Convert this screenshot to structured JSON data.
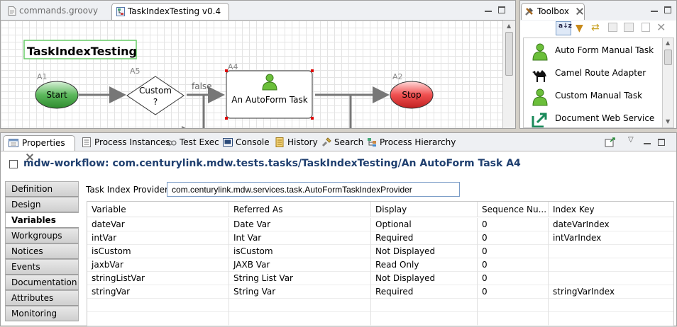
{
  "editor": {
    "tabs": [
      {
        "label": "commands.groovy"
      },
      {
        "label": "TaskIndexTesting v0.4"
      }
    ],
    "diagram": {
      "title": "TaskIndexTesting",
      "nodes": {
        "start": {
          "id": "A1",
          "label": "Start"
        },
        "decision": {
          "id": "A5",
          "label_line1": "Custom",
          "label_line2": "?"
        },
        "task": {
          "id": "A4",
          "label": "An AutoForm Task"
        },
        "stop": {
          "id": "A2",
          "label": "Stop"
        }
      },
      "edge_label": "false"
    }
  },
  "toolbox": {
    "title": "Toolbox",
    "items": [
      {
        "label": "Auto Form Manual Task",
        "icon": "person-icon"
      },
      {
        "label": "Camel Route Adapter",
        "icon": "camel-icon"
      },
      {
        "label": "Custom Manual Task",
        "icon": "person-icon"
      },
      {
        "label": "Document Web Service",
        "icon": "export-arrow-icon"
      }
    ]
  },
  "properties": {
    "tabs": [
      {
        "label": "Properties"
      },
      {
        "label": "Process Instances"
      },
      {
        "label": "Test Exec"
      },
      {
        "label": "Console"
      },
      {
        "label": "History"
      },
      {
        "label": "Search"
      },
      {
        "label": "Process Hierarchy"
      }
    ],
    "title": "mdw-workflow: com.centurylink.mdw.tests.tasks/TaskIndexTesting/An AutoForm Task A4",
    "side_tabs": [
      "Definition",
      "Design",
      "Variables",
      "Workgroups",
      "Notices",
      "Events",
      "Documentation",
      "Attributes",
      "Monitoring"
    ],
    "active_side_tab": "Variables",
    "task_index_provider_label": "Task Index Provider:",
    "task_index_provider_value": "com.centurylink.mdw.services.task.AutoFormTaskIndexProvider",
    "table": {
      "headers": [
        "Variable",
        "Referred As",
        "Display",
        "Sequence Nu...",
        "Index Key"
      ],
      "rows": [
        [
          "dateVar",
          "Date Var",
          "Optional",
          "0",
          "dateVarIndex"
        ],
        [
          "intVar",
          "Int Var",
          "Required",
          "0",
          "intVarIndex"
        ],
        [
          "isCustom",
          "isCustom",
          "Not Displayed",
          "0",
          ""
        ],
        [
          "jaxbVar",
          "JAXB Var",
          "Read Only",
          "0",
          ""
        ],
        [
          "stringListVar",
          "String List Var",
          "Not Displayed",
          "0",
          ""
        ],
        [
          "stringVar",
          "String Var",
          "Required",
          "0",
          "stringVarIndex"
        ]
      ]
    }
  },
  "colors": {
    "start_fill": "#4aa54a",
    "stop_fill": "#e84040",
    "title_color": "#1f3f6f",
    "selection_handle": "#e00000"
  }
}
